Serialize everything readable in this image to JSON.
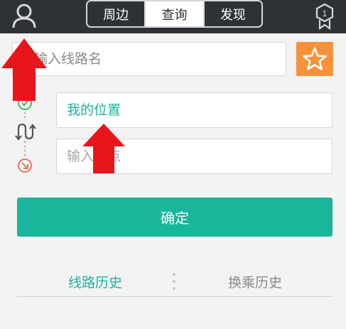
{
  "header": {
    "tabs": [
      {
        "label": "周边",
        "active": false
      },
      {
        "label": "查询",
        "active": true
      },
      {
        "label": "发现",
        "active": false
      }
    ],
    "badge_count": "1"
  },
  "line_search": {
    "placeholder": "输入线路名"
  },
  "route": {
    "start_value": "我的位置",
    "end_placeholder": "输入终点"
  },
  "confirm_label": "确定",
  "history_tabs": [
    {
      "label": "线路历史",
      "active": true
    },
    {
      "label": "换乘历史",
      "active": false
    }
  ],
  "colors": {
    "header_bg": "#2e3135",
    "accent_green": "#19b69c",
    "favorite_orange": "#f7923a",
    "end_marker_red": "#e8694f",
    "overlay_arrow_red": "#e8151b"
  }
}
